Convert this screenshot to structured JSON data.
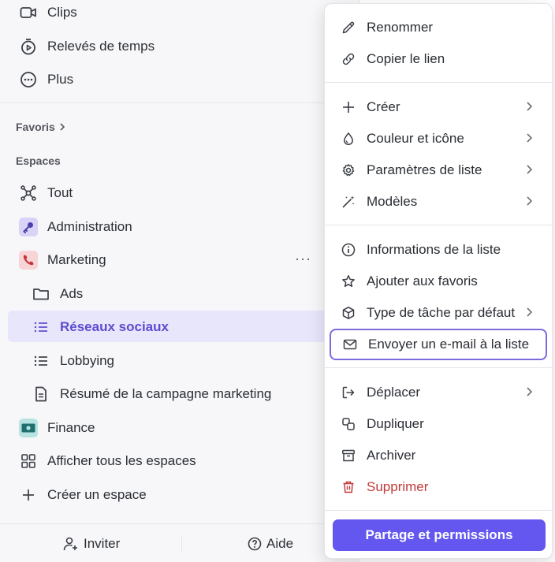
{
  "sidebar": {
    "top_items": [
      {
        "label": "Clips",
        "icon": "video-icon"
      },
      {
        "label": "Relevés de temps",
        "icon": "stopwatch-icon"
      },
      {
        "label": "Plus",
        "icon": "more-circle-icon"
      }
    ],
    "favorites_label": "Favoris",
    "spaces_label": "Espaces",
    "spaces": [
      {
        "label": "Tout",
        "icon": "hub-icon"
      },
      {
        "label": "Administration",
        "icon": "key-icon",
        "color": "#d9d4f7"
      },
      {
        "label": "Marketing",
        "icon": "phone-icon",
        "color": "#f7d4d6"
      }
    ],
    "marketing_children": [
      {
        "label": "Ads",
        "icon": "folder-icon"
      },
      {
        "label": "Réseaux sociaux",
        "icon": "list-icon"
      },
      {
        "label": "Lobbying",
        "icon": "list-icon"
      },
      {
        "label": "Résumé de la campagne marketing",
        "icon": "document-icon"
      }
    ],
    "finance": {
      "label": "Finance",
      "icon": "money-icon",
      "color": "#b9e3e3"
    },
    "view_all": "Afficher tous les espaces",
    "create_space": "Créer un espace",
    "more_dots": "···",
    "invite_label": "Inviter",
    "help_label": "Aide",
    "selected_color": "#5b4ccf"
  },
  "context_menu": {
    "group1": [
      {
        "label": "Renommer",
        "icon": "pencil-icon"
      },
      {
        "label": "Copier le lien",
        "icon": "link-icon"
      }
    ],
    "group2": [
      {
        "label": "Créer",
        "icon": "plus-icon"
      },
      {
        "label": "Couleur et icône",
        "icon": "drop-icon"
      },
      {
        "label": "Paramètres de liste",
        "icon": "gear-icon"
      },
      {
        "label": "Modèles",
        "icon": "magic-wand-icon"
      }
    ],
    "group3": [
      {
        "label": "Informations de la liste",
        "icon": "info-icon"
      },
      {
        "label": "Ajouter aux favoris",
        "icon": "star-icon"
      },
      {
        "label": "Type de tâche par défaut",
        "icon": "cube-icon"
      },
      {
        "label": "Envoyer un e-mail à la liste",
        "icon": "mail-icon"
      }
    ],
    "group4": [
      {
        "label": "Déplacer",
        "icon": "move-icon"
      },
      {
        "label": "Dupliquer",
        "icon": "duplicate-icon"
      },
      {
        "label": "Archiver",
        "icon": "archive-icon"
      },
      {
        "label": "Supprimer",
        "icon": "trash-icon"
      }
    ],
    "share_button": "Partage et permissions",
    "accent_color": "#6457f0",
    "danger_color": "#c23b3b",
    "highlight_color": "#7b6cdd"
  }
}
